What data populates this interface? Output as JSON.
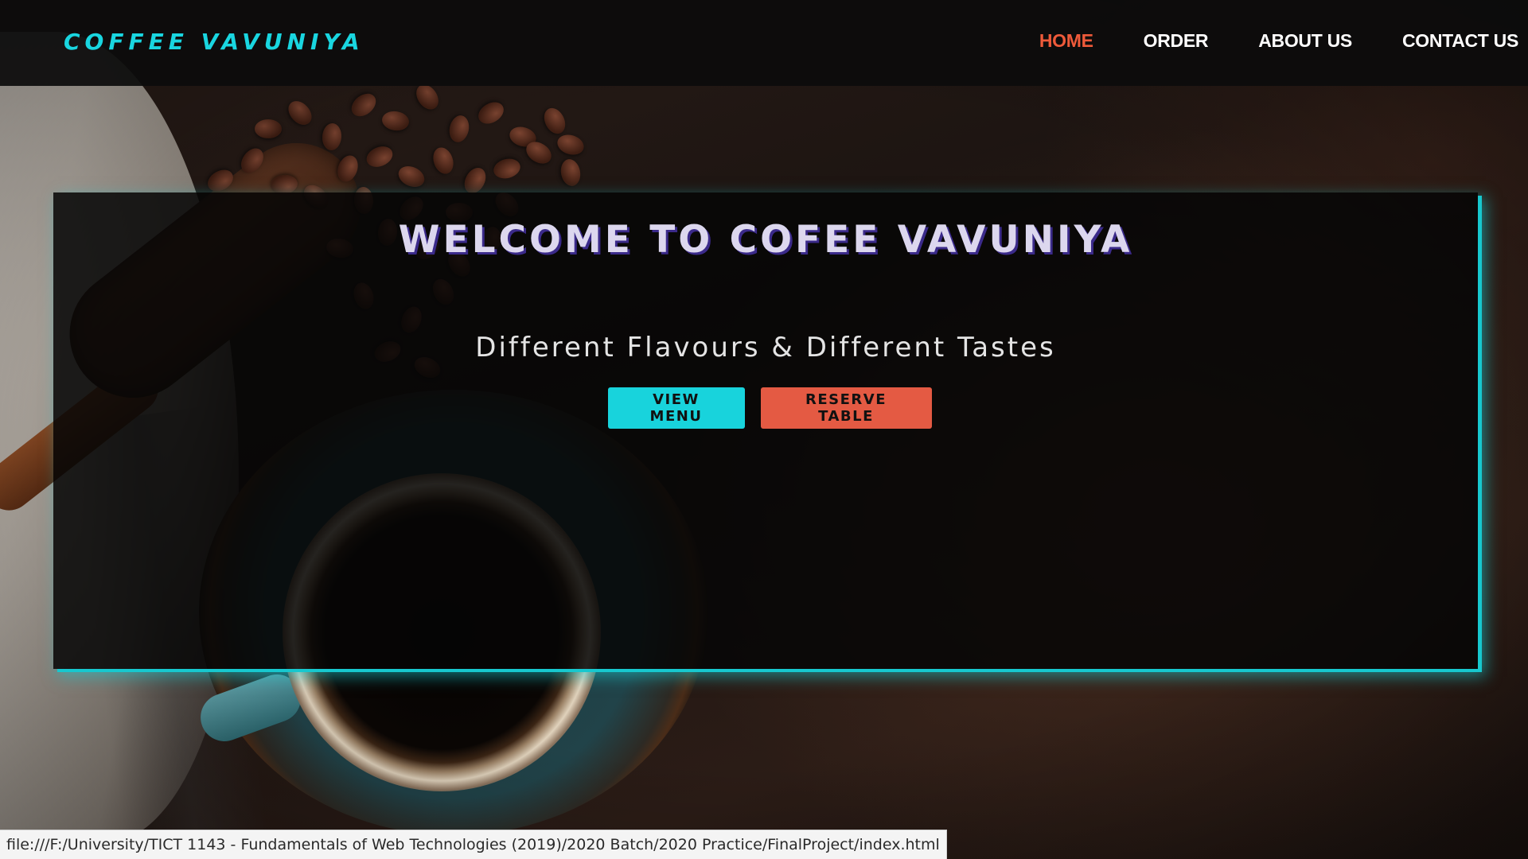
{
  "navbar": {
    "brand": "COFFEE VAVUNIYA",
    "links": [
      {
        "label": "HOME",
        "active": true
      },
      {
        "label": "ORDER",
        "active": false
      },
      {
        "label": "ABOUT US",
        "active": false
      },
      {
        "label": "CONTACT US",
        "active": false
      }
    ]
  },
  "hero": {
    "title": "WELCOME TO COFEE VAVUNIYA",
    "subtitle": "Different Flavours & Different Tastes",
    "buttons": {
      "view_menu": "VIEW MENU",
      "reserve_table": "RESERVE TABLE"
    }
  },
  "status_bar": {
    "url": "file:///F:/University/TICT 1143 - Fundamentals of Web Technologies (2019)/2020 Batch/2020 Practice/FinalProject/index.html"
  },
  "colors": {
    "brand": "#19d6e0",
    "active_link": "#ee5a3a",
    "view_menu_button": "#18d3dc",
    "reserve_button": "#e45a43",
    "hero_glow": "#17c8cf"
  },
  "background_image": {
    "icon": "coffee-cup-and-beans-photo"
  }
}
